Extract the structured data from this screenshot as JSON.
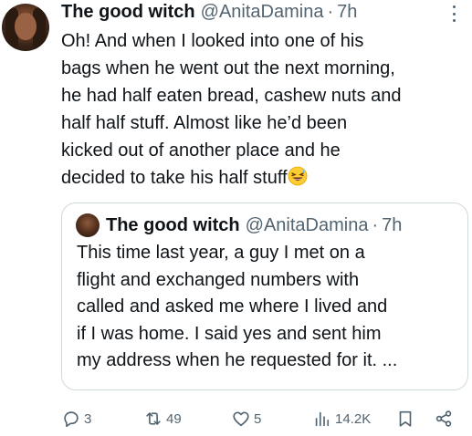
{
  "tweet": {
    "author_name": "The good witch",
    "handle": "@AnitaDamina",
    "separator": "·",
    "time": "7h",
    "text_lines": [
      "Oh! And when I looked into one of his",
      "bags when he went out the next morning,",
      "he had half eaten bread, cashew nuts and",
      "half half stuff. Almost like he’d been",
      "kicked out of another place and he",
      "decided to take his half stuff"
    ],
    "emoji": "grinning-squinting-face-with-sweat"
  },
  "quote": {
    "author_name": "The good witch",
    "handle": "@AnitaDamina",
    "separator": "·",
    "time": "7h",
    "text_lines": [
      "This time last year, a guy I met on a",
      "flight and exchanged numbers with",
      "called and asked me where I lived and",
      "if I was home. I said yes and sent him",
      "my address when he requested for it. ..."
    ]
  },
  "actions": {
    "replies": "3",
    "reposts": "49",
    "likes": "5",
    "views": "14.2K"
  },
  "colors": {
    "text": "#0f1419",
    "secondary": "#536471",
    "border": "#cfd9de"
  }
}
